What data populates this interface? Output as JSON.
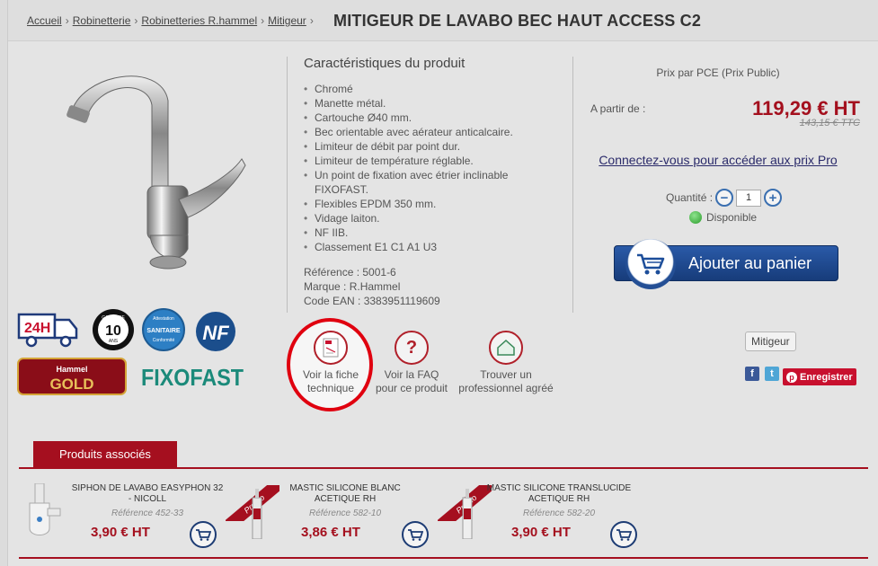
{
  "breadcrumb": {
    "items": [
      "Accueil",
      "Robinetterie",
      "Robinetteries R.hammel",
      "Mitigeur"
    ],
    "separator": "›"
  },
  "product": {
    "title": "MITIGEUR DE LAVABO BEC HAUT ACCESS C2",
    "features_title": "Caractéristiques du produit",
    "features": [
      "Chromé",
      "Manette métal.",
      "Cartouche Ø40 mm.",
      "Bec orientable avec aérateur anticalcaire.",
      "Limiteur de débit par point dur.",
      "Limiteur de température réglable.",
      "Un point de fixation avec étrier inclinable FIXOFAST.",
      "Flexibles EPDM 350 mm.",
      "Vidage laiton.",
      "NF IIB.",
      "Classement E1 C1 A1 U3"
    ],
    "reference": "Référence : 5001-6",
    "brand": "Marque : R.Hammel",
    "ean": "Code EAN : 3383951119609"
  },
  "badges": {
    "delivery": "24H",
    "guarantee_number": "10",
    "guarantee_top": "GARANTIE",
    "guarantee_bottom": "ANS",
    "sanitary": "SANITAIRE",
    "sanitary_top": "Attestation",
    "sanitary_bottom": "Conformité",
    "nf": "NF",
    "gold_top": "Hammel",
    "gold": "GOLD",
    "fixofast": "FIXOFAST"
  },
  "actions": [
    {
      "line1": "Voir la fiche",
      "line2": "technique"
    },
    {
      "line1": "Voir la FAQ",
      "line2": "pour ce produit"
    },
    {
      "line1": "Trouver un",
      "line2": "professionnel agréé"
    }
  ],
  "pricing": {
    "header": "Prix par PCE (Prix Public)",
    "from_label": "A partir de :",
    "price_ht": "119,29 € HT",
    "price_ttc": "143,15 € TTC",
    "pro_link": "Connectez-vous pour accéder aux prix Pro",
    "quantity_label": "Quantité :",
    "quantity_value": "1",
    "stock": "Disponible",
    "add_to_cart": "Ajouter au panier",
    "category_tag": "Mitigeur",
    "pinterest": "Enregistrer"
  },
  "associated": {
    "tab_label": "Produits associés",
    "promo_label": "Promo",
    "items": [
      {
        "name": "SIPHON DE LAVABO EASYPHON 32 - NICOLL",
        "ref": "Référence 452-33",
        "price": "3,90 € HT",
        "promo": false
      },
      {
        "name": "MASTIC SILICONE BLANC ACETIQUE RH",
        "ref": "Référence 582-10",
        "price": "3,86 € HT",
        "promo": true
      },
      {
        "name": "MASTIC SILICONE TRANSLUCIDE ACETIQUE RH",
        "ref": "Référence 582-20",
        "price": "3,90 € HT",
        "promo": true
      }
    ]
  }
}
